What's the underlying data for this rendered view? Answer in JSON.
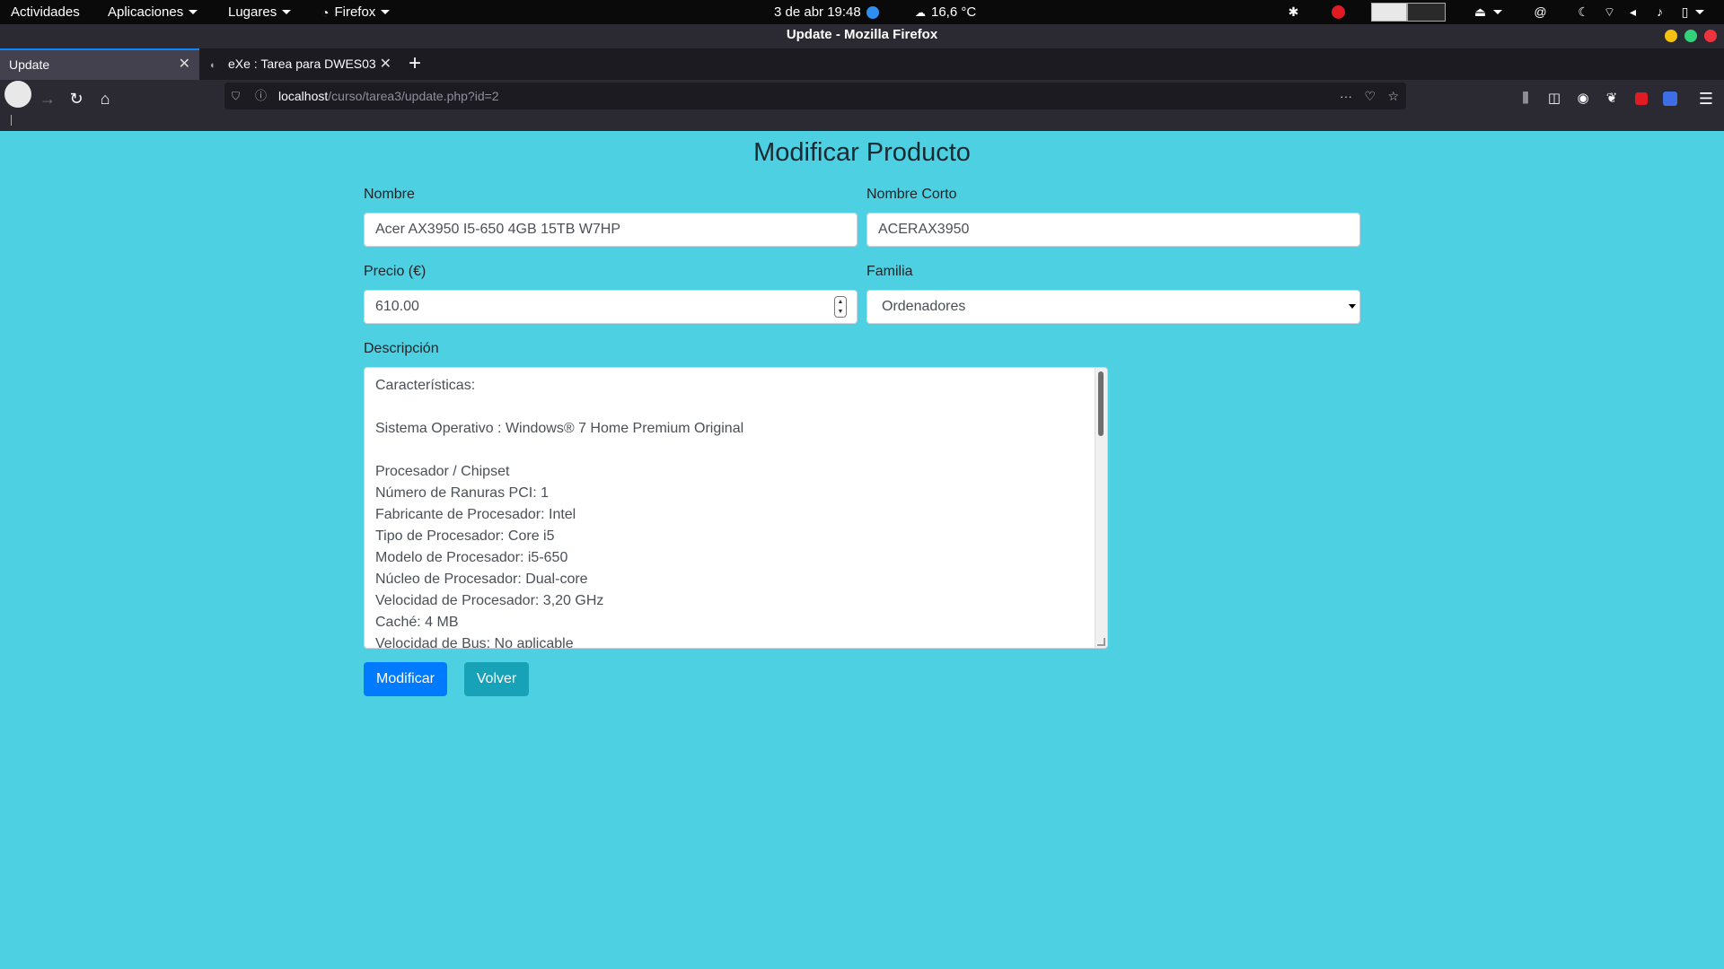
{
  "top_bar": {
    "activities": "Actividades",
    "applications": "Aplicaciones",
    "places": "Lugares",
    "app_name": "Firefox",
    "datetime": "3 de abr  19:48",
    "weather": "16,6 °C"
  },
  "window": {
    "title": "Update - Mozilla Firefox"
  },
  "tabs": [
    {
      "label": "Update",
      "active": true
    },
    {
      "label": "eXe : Tarea para DWES03",
      "active": false
    }
  ],
  "url": {
    "host": "localhost",
    "path": "/curso/tarea3/update.php?id=2"
  },
  "form": {
    "title": "Modificar Producto",
    "nombre_label": "Nombre",
    "nombre_value": "Acer AX3950 I5-650 4GB 15TB W7HP",
    "nombre_corto_label": "Nombre Corto",
    "nombre_corto_value": "ACERAX3950",
    "precio_label": "Precio (€)",
    "precio_value": "610.00",
    "familia_label": "Familia",
    "familia_value": "Ordenadores",
    "descripcion_label": "Descripción",
    "descripcion_lines": [
      "Características:",
      "",
      "Sistema Operativo : Windows® 7 Home Premium Original",
      "",
      "Procesador / Chipset",
      "Número de Ranuras PCI: 1",
      "Fabricante de Procesador: Intel",
      "Tipo de Procesador: Core i5",
      "Modelo de Procesador: i5-650",
      "Núcleo de Procesador: Dual-core",
      "Velocidad de Procesador: 3,20 GHz",
      "Caché: 4 MB",
      "Velocidad de Bus: No aplicable"
    ],
    "submit_label": "Modificar",
    "back_label": "Volver"
  },
  "colors": {
    "page_bg": "#4dd0e1",
    "primary": "#007bff",
    "info": "#17a2b8"
  }
}
